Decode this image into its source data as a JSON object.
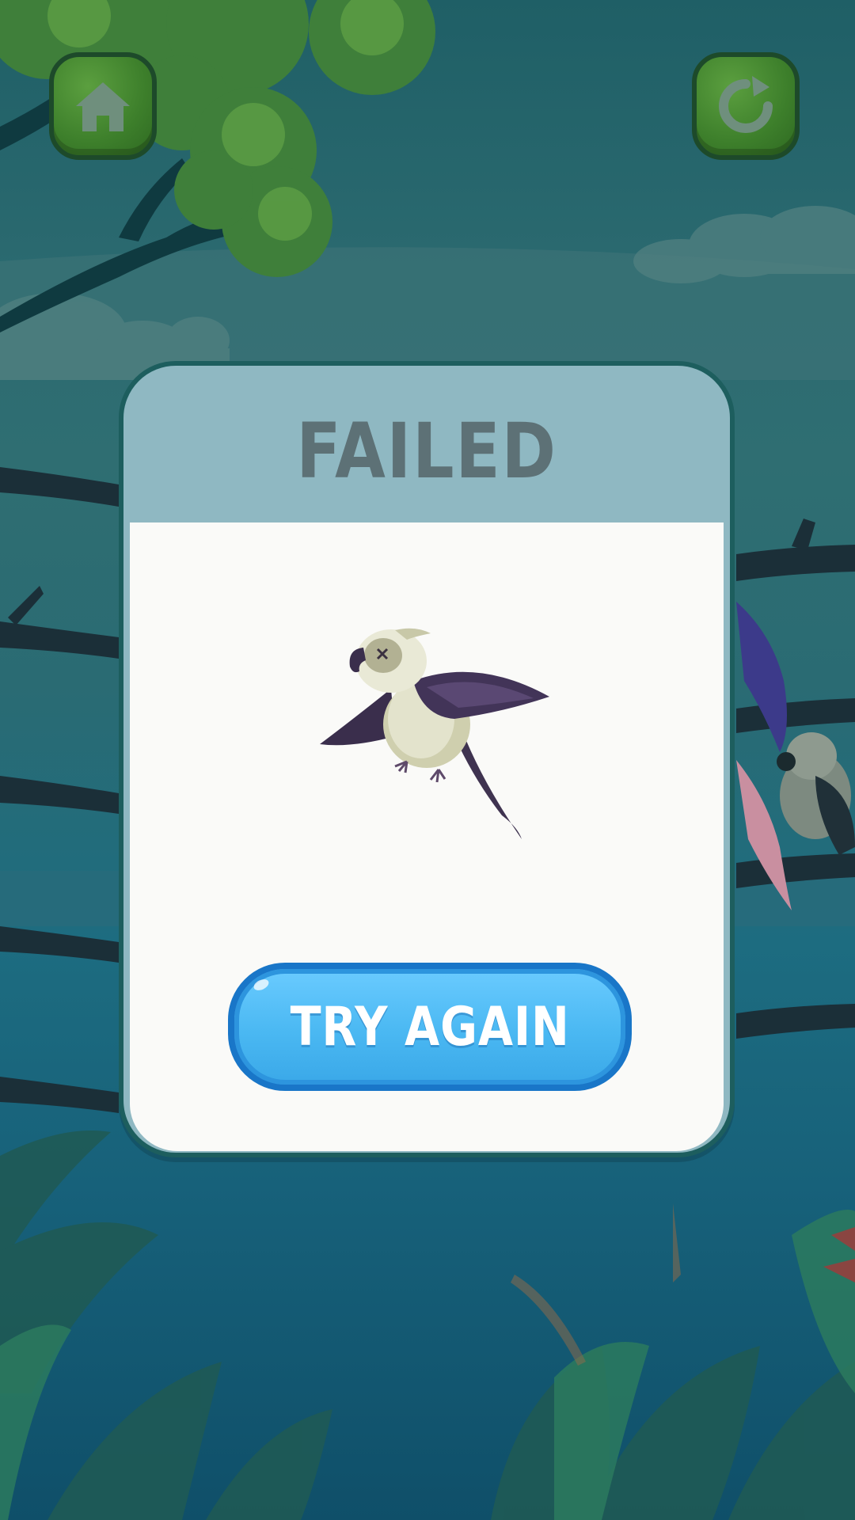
{
  "modal": {
    "title": "FAILED",
    "button_label": "TRY AGAIN"
  },
  "icons": {
    "home": "home-icon",
    "restart": "restart-icon",
    "parrot": "fainted-parrot-illustration"
  },
  "colors": {
    "modal_header": "#8fb8c2",
    "modal_title": "#5d7176",
    "button_fill": "#4ab8f2",
    "button_border": "#1976c8",
    "nav_button": "#3d7f2b"
  }
}
